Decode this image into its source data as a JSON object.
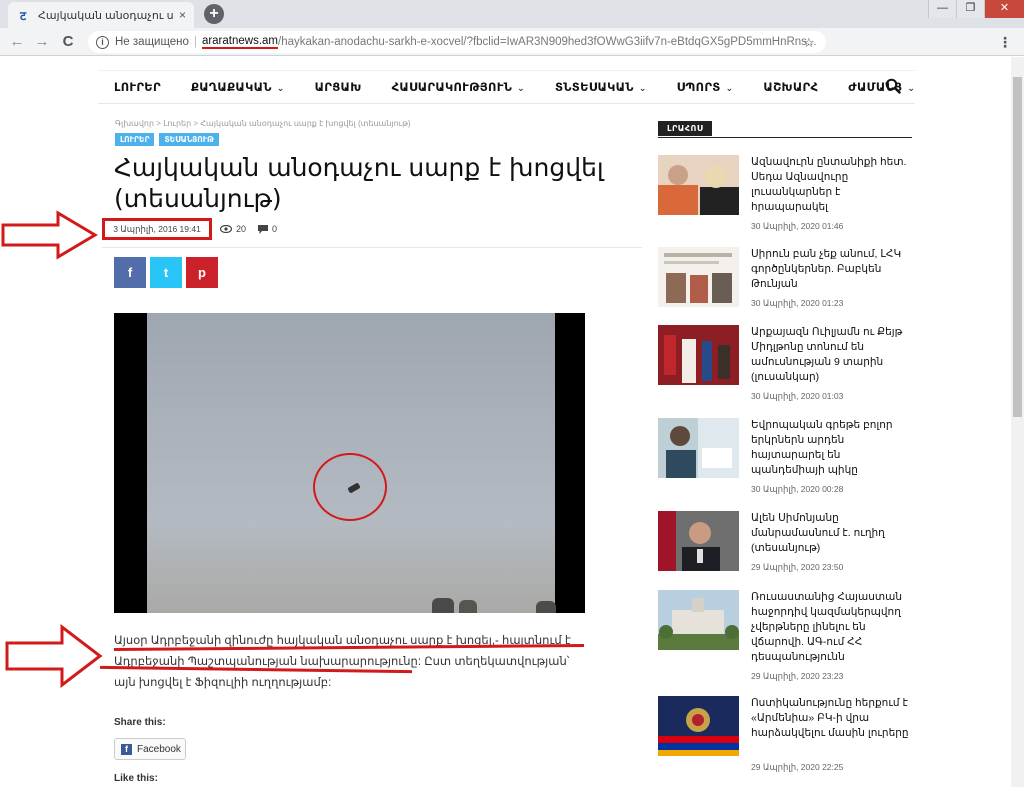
{
  "browser": {
    "tab_title": "Հայկական անօդաչու սարք է խոց",
    "tab_close": "×",
    "new_tab": "+",
    "win_min": "—",
    "win_max": "❐",
    "win_close": "✕",
    "back": "←",
    "forward": "→",
    "reload": "C",
    "info_icon": "i",
    "security_text": "Не защищено",
    "separator": "|",
    "url_domain": "araratnews.am",
    "url_path": "/haykakan-anodachu-sarkh-e-xocvel/?fbclid=IwAR3N909hed3fOWwG3iifv7n-eBtdqGX5gPD5mmHnRns...",
    "bookmark": "☆",
    "menu": "⋮"
  },
  "nav": {
    "items": [
      {
        "label": "ԼՈՒՐԵՐ",
        "dropdown": false
      },
      {
        "label": "ՔԱՂԱՔԱԿԱՆ",
        "dropdown": true
      },
      {
        "label": "ԱՐՑԱԽ",
        "dropdown": false
      },
      {
        "label": "ՀԱՍԱՐԱԿՈՒԹՅՈՒՆ",
        "dropdown": true
      },
      {
        "label": "ՏՆՏԵՍԱԿԱՆ",
        "dropdown": true
      },
      {
        "label": "ՍՊՈՐՏ",
        "dropdown": true
      },
      {
        "label": "ԱՇԽԱՐՀ",
        "dropdown": false
      },
      {
        "label": "ԺԱՄԱՆՑ",
        "dropdown": true
      }
    ],
    "chevron": "⌄"
  },
  "article": {
    "breadcrumb": "Գլխավոր  >  Լուրեր  >  Հայկական անօդաչու սարք է խոցվել (տեսանյութ)",
    "tags": [
      "ԼՈՒՐԵՐ",
      "ՏԵՍԱՆՅՈՒԹ"
    ],
    "title": "Հայկական անօդաչու սարք է խոցվել (տեսանյութ)",
    "date": "3 Ապրիլի, 2016 19:41",
    "views": "20",
    "comments": "0",
    "share_fb": "f",
    "share_tw": "t",
    "share_pi": "p",
    "body": "Այսօր Ադրբեջանի զինուժը հայկական անօդաչու սարք է խոցել,- հայտնում է Ադրբեջանի Պաշտպանության նախարարությունը: Ըստ տեղեկատվության՝ այն խոցվել է Ֆիզուլիի ուղղությամբ:",
    "share_this": "Share this:",
    "facebook_btn": "Facebook",
    "fb_square": "f",
    "like_this": "Like this:"
  },
  "sidebar": {
    "header": "ԼՐԱՀՈՍ",
    "items": [
      {
        "title": "Ազնավուրն ընտանիքի հետ. Սեդա Ազնավուրը լուսանկարներ է հրապարակել",
        "date": "30 Ապրիլի, 2020 01:46"
      },
      {
        "title": "Սիրուն բան չեք անում, ԼՀԿ գործընկերներ. Բաբկեն Թունյան",
        "date": "30 Ապրիլի, 2020 01:23"
      },
      {
        "title": "Արքայազն Ուիլյամն ու Քեյթ Միդլթոնը տոնում են ամուսնության 9 տարին (լուսանկար)",
        "date": "30 Ապրիլի, 2020 01:03"
      },
      {
        "title": "Եվրոպական գրեթե բոլոր երկրներն արդեն հայտարարել են պանդեմիայի պիկը",
        "date": "30 Ապրիլի, 2020 00:28"
      },
      {
        "title": "Ալեն Սիմոնյանը մանրամասնում է. ուղիղ (տեսանյութ)",
        "date": "29 Ապրիլի, 2020 23:50"
      },
      {
        "title": "Ռուսաստանից Հայաստան հաջորդիվ կազմակերպվող չվերթները լինելու են վճարովի. ԱԳ-ում ՀՀ դեսպանությունն",
        "date": "29 Ապրիլի, 2020 23:23"
      },
      {
        "title": "Ոստիկանությունը հերքում է «Արմենիա» ԲԿ-ի վրա հարձակվելու մասին լուրերը",
        "date": "29 Ապրիլի, 2020 22:25"
      }
    ]
  }
}
